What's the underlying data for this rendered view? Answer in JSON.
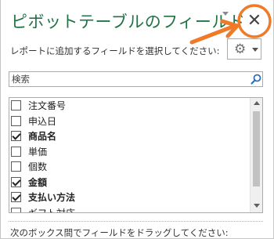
{
  "pane": {
    "title": "ピボットテーブルのフィールド",
    "close_label": "✕",
    "subtitle": "レポートに追加するフィールドを選択してください:",
    "settings_icon": "gear-icon"
  },
  "search": {
    "placeholder": "検索"
  },
  "fields": [
    {
      "label": "注文番号",
      "checked": false
    },
    {
      "label": "申込日",
      "checked": false
    },
    {
      "label": "商品名",
      "checked": true
    },
    {
      "label": "単価",
      "checked": false
    },
    {
      "label": "個数",
      "checked": false
    },
    {
      "label": "金額",
      "checked": true
    },
    {
      "label": "支払い方法",
      "checked": true
    },
    {
      "label": "ギフト対応",
      "checked": false
    }
  ],
  "footer": {
    "drag_hint": "次のボックス間でフィールドをドラッグしてください:"
  },
  "colors": {
    "title": "#217346",
    "annotation": "#f07a28"
  }
}
